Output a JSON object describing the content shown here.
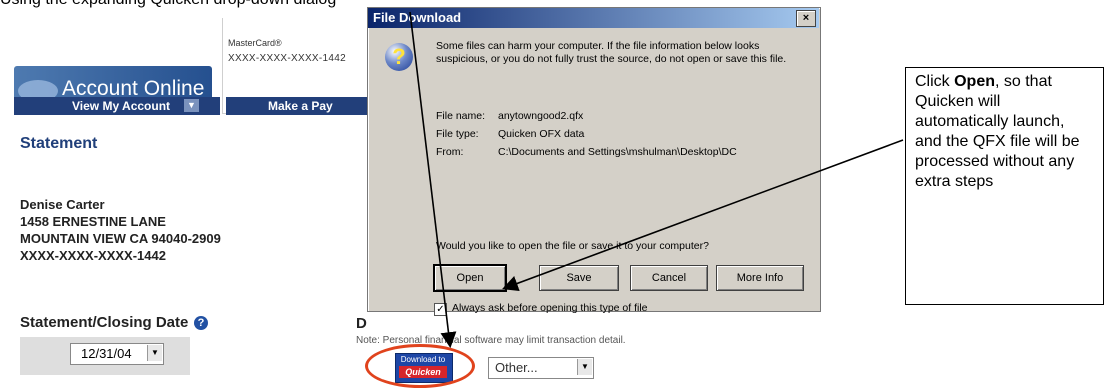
{
  "top_caption": "Using the expanding Quicken drop-down dialog",
  "background_page": {
    "logo_text": "Account Online",
    "card_name": "MasterCard®",
    "card_number": "XXXX-XXXX-XXXX-1442",
    "tabs": [
      {
        "label": "View My Account"
      },
      {
        "label": "Make a Pay"
      }
    ],
    "tab_arrow": "▼",
    "statement_title": "Statement",
    "address": [
      "Denise Carter",
      "1458 ERNESTINE LANE",
      "MOUNTAIN VIEW CA  94040-2909",
      "XXXX-XXXX-XXXX-1442"
    ],
    "closing_label": "Statement/Closing Date",
    "help_icon": "?",
    "closing_date": "12/31/04",
    "d_letter": "D",
    "note": "Note: Personal financial software may limit transaction detail.",
    "quicken_button": {
      "line1": "Download to",
      "line2": "Quicken"
    },
    "other_select": "Other..."
  },
  "dialog": {
    "title": "File Download",
    "close": "×",
    "icon": "?",
    "message": "Some files can harm your computer. If the file information below looks suspicious, or you do not fully trust the source, do not open or save this file.",
    "file_name_label": "File name:",
    "file_name": "anytowngood2.qfx",
    "file_type_label": "File type:",
    "file_type": "Quicken OFX data",
    "from_label": "From:",
    "from": "C:\\Documents and Settings\\mshulman\\Desktop\\DC",
    "question": "Would you like to open the file or save it to your computer?",
    "buttons": {
      "open": "Open",
      "save": "Save",
      "cancel": "Cancel",
      "more": "More Info"
    },
    "checkbox_mark": "✓",
    "checkbox_label": "Always ask before opening this type of file"
  },
  "callout": {
    "prefix": "Click ",
    "bold": "Open",
    "suffix": ", so that Quicken will automatically launch, and the QFX file will be processed without any extra steps"
  },
  "colors": {
    "arrow": "#000000",
    "ellipse": "#e0431d",
    "dialog_title": "#0a246a"
  }
}
